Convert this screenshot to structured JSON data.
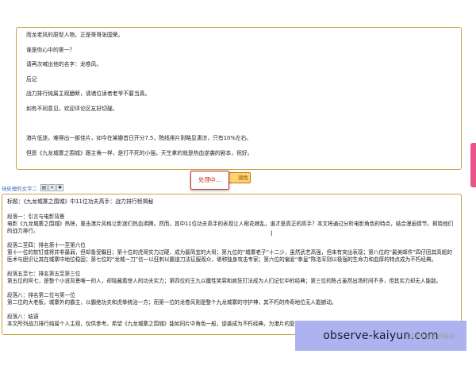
{
  "source_text": {
    "lines": [
      "而龙老风的原型人物，正是哥哥张国荣。",
      "谁是你心中的第一？",
      "请再次喊出他的名字：龙卷风。",
      "后记",
      "战力排行纯属主观臆断，请诸位读者老爷不要当真。",
      "如有不同意见，欢迎评论区友好切磋。",
      "",
      "港片低迷，难得出一部佳片，如今在某瓣首日开分7.5，院线排片则略显凄凉，只有10%左右。",
      "但愿《九龙城寨之围城》跟主角一样，是打不死的小强，天生拿的就是热血逆袭的剧本，祝好。"
    ]
  },
  "buttons": {
    "process_label": "润色",
    "processing_popup": "处理中..."
  },
  "toolbar": {
    "label": "待处理的文字二",
    "icons": [
      "copy-icon",
      "close-icon",
      "settings-icon"
    ],
    "icon_glyphs": [
      "▤",
      "✕",
      "✱"
    ]
  },
  "result_text": {
    "title": "标题：《九龙城寨之围城》中11位功夫高手：战力排行榜揭秘",
    "sections": [
      {
        "heading": "段落一：引言与电影背景",
        "body": "电影《九龙城寨之围城》热映，重击港片风格让影迷们热血沸腾。然而，其中11位功夫高手的表现让人眼花缭乱，谁才是真正的高手？本文将通过分析电影角色的特点，结合漫画情节，揭晓他们的战力排行。"
      },
      {
        "heading": "段落二至四：排名第十一至第六位",
        "body": "第十一位的软钉或将并非最弱，但却备受瞩目；第十位的虎哥实力过硬，成为最简宜的大哥；第九位的“城寨老子”十二少，虽然武艺高强，但未有突出表现；第八位的“最美邮件”四仔因其高超的医术与胆识让其在城寨中地位稳固；第七位的“龙城一刀”信一以狂刺以霸道刀法征服观众，堪称独身攻击专家；第六位的偏爱“拳皇”陈洛军则以极强的生命力和血厚的特点成为不朽经典。"
      },
      {
        "heading": "段落五至七：排名第五至第三位",
        "body": "第五位的阿七，是整个小说背景唯一的人，却隐藏着惊人的功夫实力；第四位的王九以魔性笑容和疯狂打法成为人们记忆中的经典；第三位的陈占虽然出场时间不多，但其实力却无人能敌。"
      },
      {
        "heading": "段落八：排名第二位与第一位",
        "body": "第二位的大老板，城寨外的霸主，以霸绝功夫和虎拳统治一方；而第一位的龙卷风则是整个九龙城寨的守护神，其不朽的传奇地位无人能撼动。"
      },
      {
        "heading": "段落八：结语",
        "body": "本文所列战力排行纯属个人主观，仅供参考。希望《九龙城寨之围城》能如同片中角色一般，逆袭成为不朽经典，为港片的复兴做出贡献。"
      }
    ]
  },
  "watermarks": {
    "csdn": "CSDN @老余编程",
    "site": "observe-kaiyun.com"
  },
  "colors": {
    "border": "#c9a248",
    "processing_red": "#c0352b",
    "button_yellow": "#ffd56b",
    "side_tab_pink": "#e8548a",
    "site_banner": "#aeb3f0"
  }
}
